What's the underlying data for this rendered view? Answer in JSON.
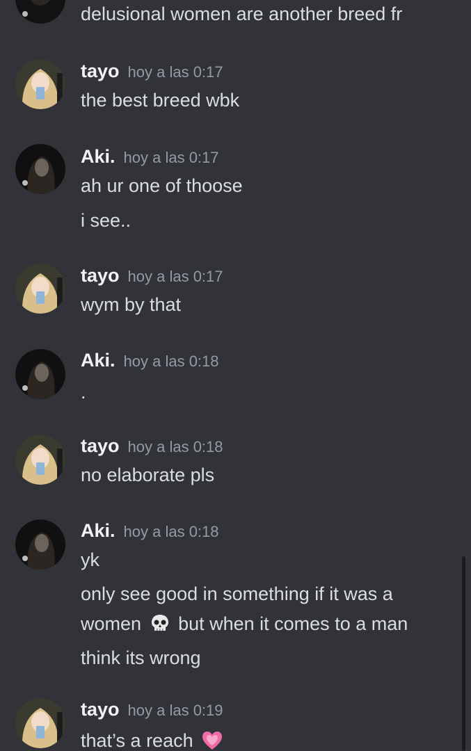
{
  "colors": {
    "background": "#313338",
    "username": "#f2f3f5",
    "timestamp": "#949ba4",
    "text": "#dbdee1"
  },
  "messages": [
    {
      "author": "",
      "lines": [
        "delusional women are another breed fr"
      ]
    },
    {
      "author": "tayo",
      "timestamp": "hoy a las 0:17",
      "avatar": "tayo-avatar",
      "lines": [
        "the best breed wbk"
      ]
    },
    {
      "author": "Aki.",
      "timestamp": "hoy a las 0:17",
      "avatar": "aki-avatar",
      "lines": [
        "ah ur one of thoose",
        "i see.."
      ]
    },
    {
      "author": "tayo",
      "timestamp": "hoy a las 0:17",
      "avatar": "tayo-avatar",
      "lines": [
        "wym by that"
      ]
    },
    {
      "author": "Aki.",
      "timestamp": "hoy a las 0:18",
      "avatar": "aki-avatar",
      "lines": [
        "."
      ]
    },
    {
      "author": "tayo",
      "timestamp": "hoy a las 0:18",
      "avatar": "tayo-avatar",
      "lines": [
        "no elaborate pls"
      ]
    },
    {
      "author": "Aki.",
      "timestamp": "hoy a las 0:18",
      "avatar": "aki-avatar",
      "lines": [
        "yk"
      ],
      "long_message": {
        "part1": "only see good in something if it was a women",
        "emoji": "skull-emoji",
        "part2": "but when it comes to a man think its wrong"
      }
    },
    {
      "author": "tayo",
      "timestamp": "hoy a las 0:19",
      "avatar": "tayo-avatar",
      "lines": [
        "that’s a reach"
      ],
      "emoji": "pink-heart-emoji"
    }
  ]
}
